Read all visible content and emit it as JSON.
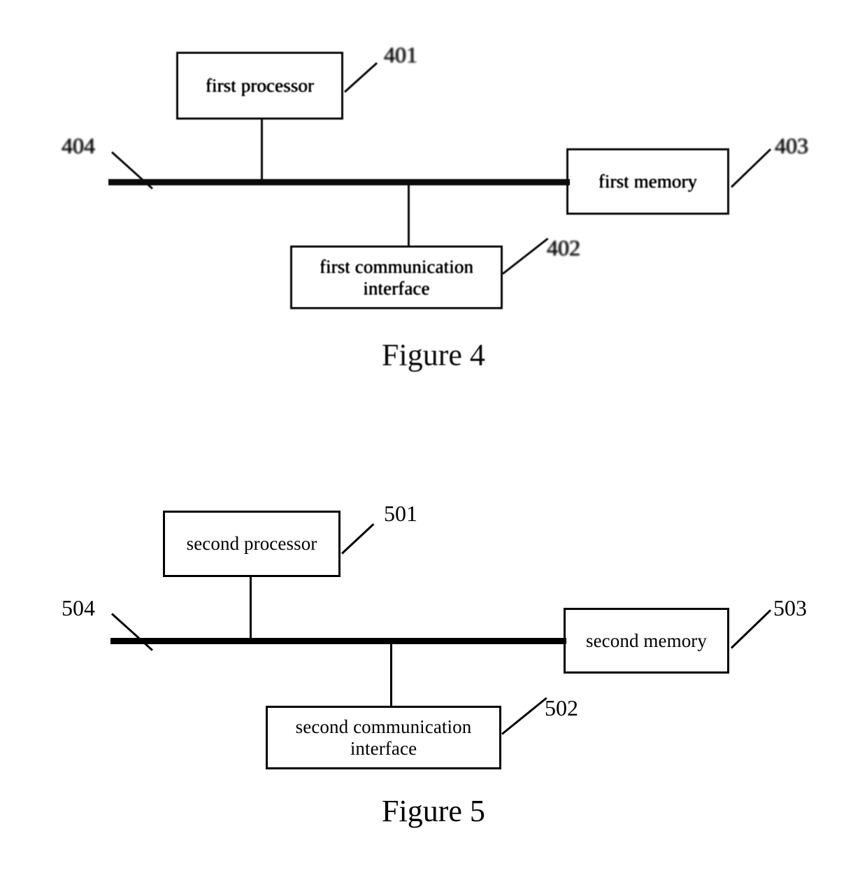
{
  "document": {
    "type": "patent-drawing-sheet",
    "background_color": "#ffffff",
    "ink_color": "#000000"
  },
  "figures": [
    {
      "id": "figure-4",
      "caption": "Figure 4",
      "rendering": "degraded-scan",
      "blocks": [
        {
          "key": "processor",
          "label": "first processor",
          "ref": "401"
        },
        {
          "key": "comm",
          "label": "first communication interface",
          "ref": "402"
        },
        {
          "key": "memory",
          "label": "first memory",
          "ref": "403"
        },
        {
          "key": "bus",
          "label": "",
          "ref": "404"
        }
      ],
      "refs": {
        "processor": "401",
        "comm": "402",
        "memory": "403",
        "bus": "404"
      },
      "labels": {
        "processor": "first processor",
        "comm_line1": "first communication",
        "comm_line2": "interface",
        "memory": "first memory"
      }
    },
    {
      "id": "figure-5",
      "caption": "Figure 5",
      "rendering": "crisp",
      "blocks": [
        {
          "key": "processor",
          "label": "second processor",
          "ref": "501"
        },
        {
          "key": "comm",
          "label": "second communication interface",
          "ref": "502"
        },
        {
          "key": "memory",
          "label": "second memory",
          "ref": "503"
        },
        {
          "key": "bus",
          "label": "",
          "ref": "504"
        }
      ],
      "refs": {
        "processor": "501",
        "comm": "502",
        "memory": "503",
        "bus": "504"
      },
      "labels": {
        "processor": "second processor",
        "comm_line1": "second communication",
        "comm_line2": "interface",
        "memory": "second memory"
      }
    }
  ]
}
